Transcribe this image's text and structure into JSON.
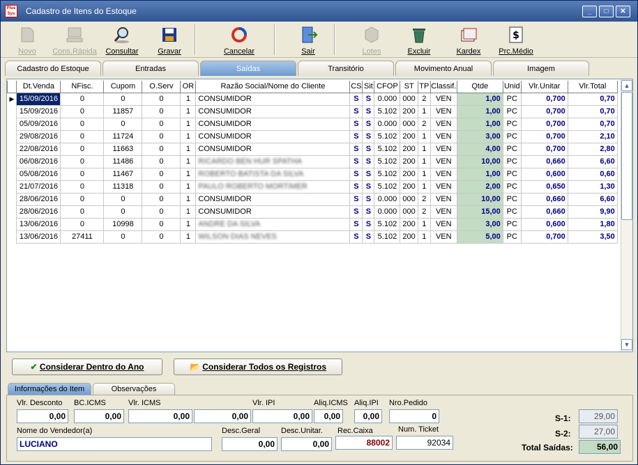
{
  "window": {
    "title": "Cadastro de Itens do Estoque",
    "app_icon_text": "Plus Sys",
    "minimize": "_",
    "maximize": "□",
    "close": "✕"
  },
  "toolbar": {
    "novo": "Novo",
    "cons_rapida": "Cons.Rápida",
    "consultar": "Consultar",
    "gravar": "Gravar",
    "cancelar": "Cancelar",
    "sair": "Sair",
    "lotes": "Lotes",
    "excluir": "Excluir",
    "kardex": "Kardex",
    "prc_medio": "Prc.Médio"
  },
  "tabs": [
    "Cadastro do Estoque",
    "Entradas",
    "Saídas",
    "Transitório",
    "Movimento Anual",
    "Imagem"
  ],
  "grid": {
    "columns": [
      "Dt.Venda",
      "NFisc.",
      "Cupom",
      "O.Serv",
      "OR",
      "Razão Social/Nome do Cliente",
      "CS",
      "Sit",
      "CFOP",
      "ST",
      "TP",
      "Classif.",
      "Qtde",
      "Unid",
      "Vlr.Unitar",
      "Vlr.Total"
    ],
    "rows": [
      [
        "15/09/2016",
        "0",
        "0",
        "0",
        "1",
        "CONSUMIDOR",
        "S",
        "S",
        "0.000",
        "000",
        "2",
        "VEN",
        "1,00",
        "PC",
        "0,700",
        "0,70"
      ],
      [
        "15/09/2016",
        "0",
        "11857",
        "0",
        "1",
        "CONSUMIDOR",
        "S",
        "S",
        "5.102",
        "200",
        "1",
        "VEN",
        "1,00",
        "PC",
        "0,700",
        "0,70"
      ],
      [
        "05/09/2016",
        "0",
        "0",
        "0",
        "1",
        "CONSUMIDOR",
        "S",
        "S",
        "0.000",
        "000",
        "2",
        "VEN",
        "1,00",
        "PC",
        "0,700",
        "0,70"
      ],
      [
        "29/08/2016",
        "0",
        "11724",
        "0",
        "1",
        "CONSUMIDOR",
        "S",
        "S",
        "5.102",
        "200",
        "1",
        "VEN",
        "3,00",
        "PC",
        "0,700",
        "2,10"
      ],
      [
        "22/08/2016",
        "0",
        "11663",
        "0",
        "1",
        "CONSUMIDOR",
        "S",
        "S",
        "5.102",
        "200",
        "1",
        "VEN",
        "4,00",
        "PC",
        "0,700",
        "2,80"
      ],
      [
        "06/08/2016",
        "0",
        "11486",
        "0",
        "1",
        "RICARDO BEN HUR SPATHA",
        "S",
        "S",
        "5.102",
        "200",
        "1",
        "VEN",
        "10,00",
        "PC",
        "0,660",
        "6,60"
      ],
      [
        "05/08/2016",
        "0",
        "11467",
        "0",
        "1",
        "ROBERTO BATISTA DA SILVA",
        "S",
        "S",
        "5.102",
        "200",
        "1",
        "VEN",
        "1,00",
        "PC",
        "0,600",
        "0,60"
      ],
      [
        "21/07/2016",
        "0",
        "11318",
        "0",
        "1",
        "PAULO ROBERTO MORTIMER",
        "S",
        "S",
        "5.102",
        "200",
        "1",
        "VEN",
        "2,00",
        "PC",
        "0,650",
        "1,30"
      ],
      [
        "28/06/2016",
        "0",
        "0",
        "0",
        "1",
        "CONSUMIDOR",
        "S",
        "S",
        "0.000",
        "000",
        "2",
        "VEN",
        "10,00",
        "PC",
        "0,660",
        "6,60"
      ],
      [
        "28/06/2016",
        "0",
        "0",
        "0",
        "1",
        "CONSUMIDOR",
        "S",
        "S",
        "0.000",
        "000",
        "2",
        "VEN",
        "15,00",
        "PC",
        "0,660",
        "9,90"
      ],
      [
        "13/06/2016",
        "0",
        "10998",
        "0",
        "1",
        "ANDRE DA SILVA",
        "S",
        "S",
        "5.102",
        "200",
        "1",
        "VEN",
        "3,00",
        "PC",
        "0,600",
        "1,80"
      ],
      [
        "13/06/2016",
        "27411",
        "0",
        "0",
        "1",
        "WILSON DIAS NEVES",
        "S",
        "S",
        "5.102",
        "200",
        "1",
        "VEN",
        "5,00",
        "PC",
        "0,700",
        "3,50"
      ]
    ]
  },
  "buttons": {
    "dentro_ano": "Considerar Dentro do Ano",
    "todos": "Considerar Todos os Registros"
  },
  "info_tabs": [
    "Informações do Item",
    "Observações"
  ],
  "info": {
    "vlr_desconto_label": "Vlr. Desconto",
    "vlr_desconto": "0,00",
    "bc_icms_label": "BC.ICMS",
    "bc_icms": "0,00",
    "vlr_icms_label": "Vlr. ICMS",
    "vlr_icms": "0,00",
    "extra_value": "0,00",
    "vlr_ipi_label": "Vlr. IPI",
    "vlr_ipi": "0,00",
    "aliq_icms_label": "Aliq.ICMS",
    "aliq_icms": "0,00",
    "aliq_ipi_label": "Aliq.IPI",
    "aliq_ipi": "0,00",
    "nro_pedido_label": "Nro.Pedido",
    "nro_pedido": "0",
    "vendedor_label": "Nome do Vendedor(a)",
    "vendedor": "LUCIANO",
    "desc_geral_label": "Desc.Geral",
    "desc_geral": "0,00",
    "desc_unitar_label": "Desc.Unitar.",
    "desc_unitar": "0,00",
    "rec_caixa_label": "Rec.Caixa",
    "rec_caixa": "88002",
    "num_ticket_label": "Num. Ticket",
    "num_ticket": "92034",
    "s1_label": "S-1:",
    "s1": "29,00",
    "s2_label": "S-2:",
    "s2": "27,00",
    "total_label": "Total Saídas:",
    "total": "56,00"
  }
}
